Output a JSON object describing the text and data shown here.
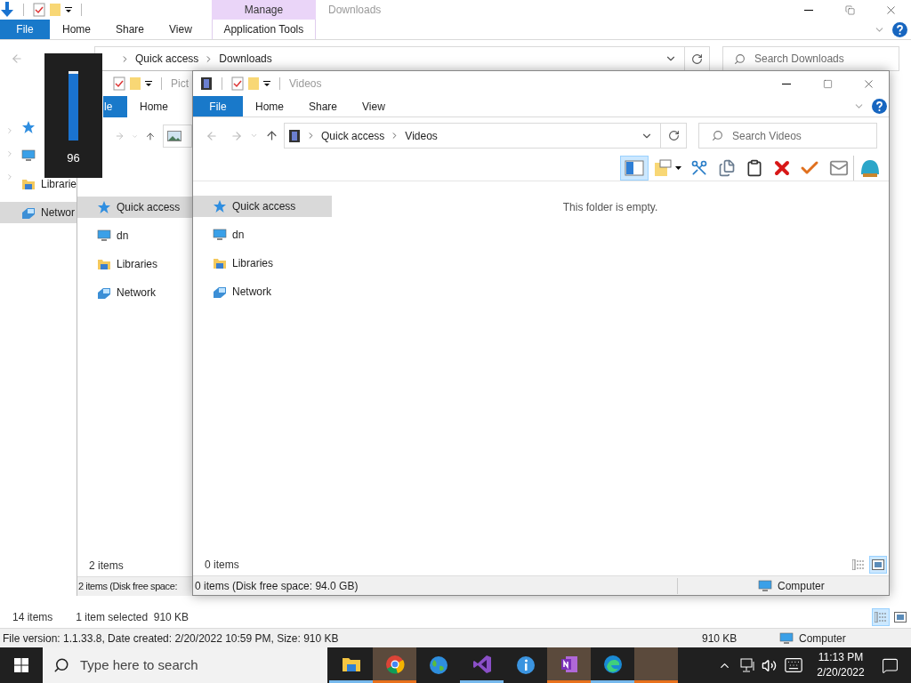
{
  "downloads_window": {
    "title": "Downloads",
    "context_group": "Manage",
    "tabs": [
      {
        "label": "File",
        "kind": "file"
      },
      {
        "label": "Home",
        "kind": "tab"
      },
      {
        "label": "Share",
        "kind": "tab"
      },
      {
        "label": "View",
        "kind": "tab"
      },
      {
        "label": "Application Tools",
        "kind": "context"
      }
    ],
    "breadcrumbs": [
      "Quick access",
      "Downloads"
    ],
    "search_placeholder": "Search Downloads",
    "nav_items": [
      {
        "kind": "star",
        "selected": false
      },
      {
        "kind": "computer",
        "selected": false
      },
      {
        "label": "Librarie",
        "kind": "library",
        "selected": false
      },
      {
        "label": "Networ",
        "kind": "network",
        "selected": true
      }
    ],
    "status": {
      "count": "14 items",
      "selection": "1 item selected  910 KB"
    },
    "views": [
      {
        "kind": "details",
        "selected": true
      },
      {
        "kind": "large",
        "selected": false
      }
    ],
    "details_bar": {
      "info": "File version: 1.1.33.8, Date created: 2/20/2022 10:59 PM, Size: 910 KB",
      "size": "910 KB",
      "location": "Computer"
    }
  },
  "pictures_window": {
    "title": "Pict",
    "tabs": [
      {
        "label": "le",
        "kind": "file"
      },
      {
        "label": "Home",
        "kind": "tab"
      }
    ],
    "nav_items": [
      {
        "label": "Quick access",
        "kind": "star",
        "selected": true
      },
      {
        "label": "dn",
        "kind": "computer",
        "selected": false
      },
      {
        "label": "Libraries",
        "kind": "library",
        "selected": false
      },
      {
        "label": "Network",
        "kind": "network",
        "selected": false
      }
    ],
    "status_count": "2 items",
    "status_bar": "2 items (Disk free space:"
  },
  "videos_window": {
    "title": "Videos",
    "tabs": [
      {
        "label": "File",
        "kind": "file"
      },
      {
        "label": "Home",
        "kind": "tab"
      },
      {
        "label": "Share",
        "kind": "tab"
      },
      {
        "label": "View",
        "kind": "tab"
      }
    ],
    "breadcrumbs": [
      "Quick access",
      "Videos"
    ],
    "search_placeholder": "Search Videos",
    "toolbar": [
      {
        "kind": "pane",
        "selected": true
      },
      {
        "kind": "properties",
        "selected": false
      },
      {
        "kind": "cut",
        "selected": false
      },
      {
        "kind": "copy",
        "selected": false
      },
      {
        "kind": "paste",
        "selected": false
      },
      {
        "kind": "delete",
        "selected": false
      },
      {
        "kind": "check",
        "selected": false
      },
      {
        "kind": "mail",
        "selected": false
      },
      {
        "kind": "shell",
        "selected": false
      }
    ],
    "nav_items": [
      {
        "label": "Quick access",
        "kind": "star",
        "selected": true
      },
      {
        "label": "dn",
        "kind": "computer",
        "selected": false
      },
      {
        "label": "Libraries",
        "kind": "library",
        "selected": false
      },
      {
        "label": "Network",
        "kind": "network",
        "selected": false
      }
    ],
    "empty_message": "This folder is empty.",
    "status_count": "0 items",
    "views": [
      {
        "kind": "details",
        "selected": false
      },
      {
        "kind": "large",
        "selected": true
      }
    ],
    "status_bar": {
      "info": "0 items (Disk free space: 94.0 GB)",
      "location": "Computer"
    }
  },
  "volume_osd": {
    "level": 0.96,
    "reading": "96"
  },
  "taskbar": {
    "search_placeholder": "Type here to search",
    "apps": [
      {
        "kind": "folder",
        "running": true,
        "active": false
      },
      {
        "kind": "chrome",
        "running": true,
        "active": true
      },
      {
        "kind": "globe",
        "running": false,
        "active": false
      },
      {
        "kind": "studio",
        "running": true,
        "active": false
      },
      {
        "kind": "info",
        "running": false,
        "active": false
      },
      {
        "kind": "notebook",
        "running": true,
        "active": true
      },
      {
        "kind": "edge",
        "running": true,
        "active": false
      },
      {
        "kind": "blank",
        "running": true,
        "active": true
      }
    ],
    "clock": {
      "time": "11:13 PM",
      "date": "2/20/2022"
    }
  }
}
